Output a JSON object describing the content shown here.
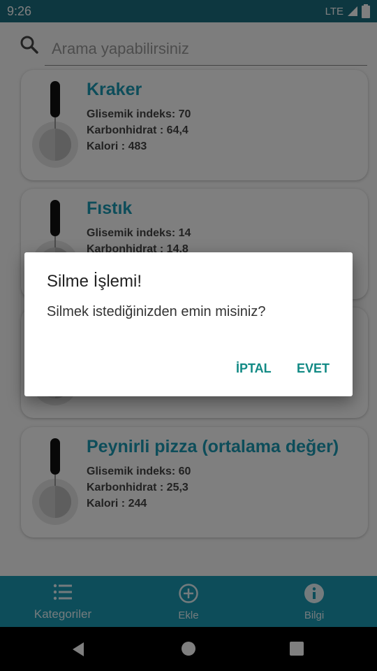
{
  "status_bar": {
    "time": "9:26",
    "network": "LTE"
  },
  "search": {
    "placeholder": "Arama yapabilirsiniz",
    "value": ""
  },
  "foods": [
    {
      "name": "Kraker",
      "gi": "Glisemik indeks: 70",
      "carb": "Karbonhidrat : 64,4",
      "cal": "Kalori : 483"
    },
    {
      "name": "Fıstık",
      "gi": "Glisemik indeks: 14",
      "carb": "Karbonhidrat : 14,8",
      "cal": ""
    },
    {
      "name": "",
      "gi": "",
      "carb": "",
      "cal": ""
    },
    {
      "name": "Peynirli pizza (ortalama değer)",
      "gi": "Glisemik indeks: 60",
      "carb": "Karbonhidrat : 25,3",
      "cal": "Kalori : 244"
    }
  ],
  "bottom_nav": {
    "items": [
      {
        "label": "Kategoriler",
        "icon": "list-icon"
      },
      {
        "label": "Ekle",
        "icon": "add-circle-icon"
      },
      {
        "label": "Bilgi",
        "icon": "info-icon"
      }
    ]
  },
  "dialog": {
    "title": "Silme İşlemi!",
    "message": "Silmek istediğinizden emin misiniz?",
    "cancel_label": "İPTAL",
    "confirm_label": "EVET"
  },
  "colors": {
    "status_bar": "#1a6f80",
    "accent": "#1b9bb5",
    "dialog_button": "#128a85"
  }
}
